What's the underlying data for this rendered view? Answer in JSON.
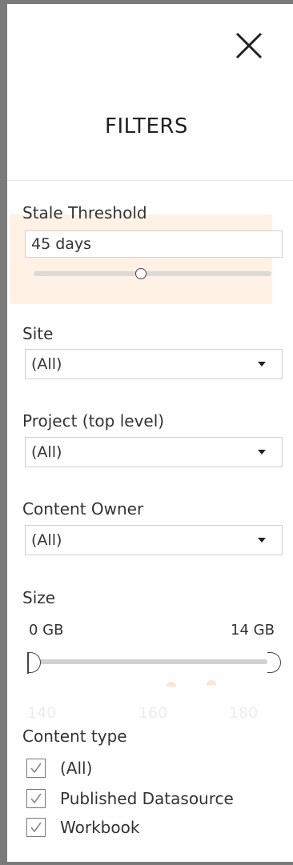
{
  "panel": {
    "title": "FILTERS",
    "close_icon": "close-icon"
  },
  "stale_threshold": {
    "label": "Stale Threshold",
    "value": "45 days",
    "slider_fraction": 0.45
  },
  "site": {
    "label": "Site",
    "value": "(All)"
  },
  "project": {
    "label": "Project (top level)",
    "value": "(All)"
  },
  "content_owner": {
    "label": "Content Owner",
    "value": "(All)"
  },
  "size": {
    "label": "Size",
    "min": "0 GB",
    "max": "14 GB"
  },
  "background_ticks": [
    "140",
    "160",
    "180"
  ],
  "content_type": {
    "label": "Content type",
    "options": [
      {
        "label": "(All)",
        "checked": true
      },
      {
        "label": "Published Datasource",
        "checked": true
      },
      {
        "label": "Workbook",
        "checked": true
      }
    ]
  },
  "colors": {
    "highlight": "#fff1e4",
    "frame": "#7a7a7a"
  }
}
